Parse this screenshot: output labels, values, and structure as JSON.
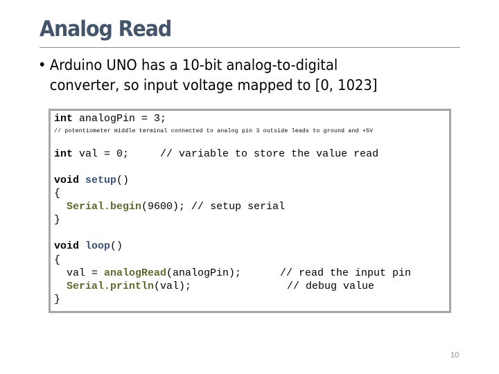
{
  "slide": {
    "title": "Analog Read",
    "bullet": {
      "line1": "Arduino UNO has a 10-bit analog-to-digital",
      "line2": "converter, so input voltage mapped to [0, 1023]"
    },
    "page_number": "10"
  },
  "code": {
    "l1": {
      "kw": "int",
      "rest": " analogPin = 3;"
    },
    "l2": "// potentiometer middle terminal connected to analog pin 3 outside leads to ground and +5V",
    "l3": {
      "kw": "int",
      "rest": " val = 0;     // variable to store the value read"
    },
    "l4": {
      "kw": "void",
      "sp": " ",
      "fn": "setup",
      "rest": "()"
    },
    "l5": "{",
    "l6": {
      "indent": "  ",
      "lib": "Serial.begin",
      "rest": "(9600); // setup serial"
    },
    "l7": "}",
    "l8": {
      "kw": "void",
      "sp": " ",
      "fn": "loop",
      "rest": "()"
    },
    "l9": "{",
    "l10": {
      "pre": "  val = ",
      "lib": "analogRead",
      "rest": "(analogPin);",
      "comment": "// read the input pin"
    },
    "l11": {
      "indent": "  ",
      "lib": "Serial.println",
      "rest": "(val);",
      "comment": "// debug value"
    },
    "l12": "}"
  },
  "colors": {
    "title": "#44546a",
    "keyword_function": "#3a5277",
    "library_call": "#596b2e",
    "code_border": "#a6a6a6"
  }
}
